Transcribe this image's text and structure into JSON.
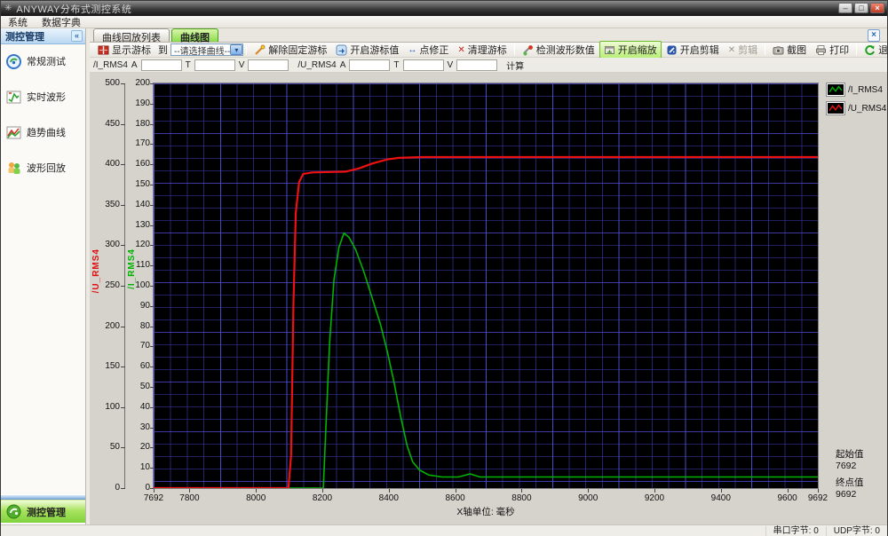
{
  "window": {
    "title": "ANYWAY分布式测控系统"
  },
  "icons": {
    "minimize": "–",
    "restore": "□",
    "close": "×",
    "collapse": "«",
    "dropdown": "▾",
    "tab_close": "×",
    "clear": "✕",
    "clip_disabled": "✕",
    "point_fix": "↔",
    "app": "✳"
  },
  "menu": {
    "items": [
      "系统",
      "数据字典"
    ]
  },
  "sidebar": {
    "header": "测控管理",
    "items": [
      {
        "label": "常规测试"
      },
      {
        "label": "实时波形"
      },
      {
        "label": "趋势曲线"
      },
      {
        "label": "波形回放"
      }
    ],
    "bottom_button": "测控管理"
  },
  "tabs": {
    "items": [
      {
        "label": "曲线回放列表"
      },
      {
        "label": "曲线图"
      }
    ]
  },
  "toolbar": {
    "show_cursor": "显示游标",
    "to_label": "到",
    "curve_select_value": "--请选择曲线--",
    "remove_fixed_cursor": "解除固定游标",
    "open_cursor_value": "开启游标值",
    "point_fix": "点修正",
    "clear_cursor": "清理游标",
    "detect_values": "检测波形数值",
    "open_zoom": "开启缩放",
    "open_clip": "开启剪辑",
    "clip": "剪辑",
    "screenshot": "截图",
    "print": "打印",
    "exit": "退出"
  },
  "fields": {
    "groups": [
      {
        "name": "/I_RMS4",
        "sub": [
          "A",
          "T",
          "V"
        ],
        "values": [
          "",
          "",
          ""
        ]
      },
      {
        "name": "/U_RMS4",
        "sub": [
          "A",
          "T",
          "V"
        ],
        "values": [
          "",
          "",
          ""
        ]
      }
    ],
    "calc_label": "计算"
  },
  "chart_data": {
    "type": "line",
    "x_unit_label": "X轴单位: 毫秒",
    "x_range": [
      7692,
      9692
    ],
    "x_ticks": [
      7692,
      7800,
      8000,
      8200,
      8400,
      8600,
      8800,
      9000,
      9200,
      9400,
      9600,
      9692
    ],
    "grid": true,
    "axes": {
      "left_outer": {
        "label": "/U_RMS4",
        "color": "#e01010",
        "min": 0,
        "max": 500,
        "step": 50
      },
      "left_inner": {
        "label": "/I_RMS4",
        "color": "#00b400",
        "min": 0,
        "max": 200,
        "step": 10
      }
    },
    "legend": [
      {
        "label": "/I_RMS4",
        "color": "#00b400"
      },
      {
        "label": "/U_RMS4",
        "color": "#ee1111"
      }
    ],
    "series": [
      {
        "name": "I_RMS4",
        "color": "#00b400",
        "axis": "left_inner",
        "width": 1.6,
        "points": [
          [
            7692,
            0
          ],
          [
            8203,
            0
          ],
          [
            8212,
            35
          ],
          [
            8222,
            72
          ],
          [
            8235,
            103
          ],
          [
            8250,
            119
          ],
          [
            8265,
            126
          ],
          [
            8280,
            124
          ],
          [
            8300,
            118
          ],
          [
            8325,
            107
          ],
          [
            8350,
            94
          ],
          [
            8375,
            81
          ],
          [
            8395,
            68
          ],
          [
            8415,
            53
          ],
          [
            8435,
            36
          ],
          [
            8455,
            21
          ],
          [
            8472,
            13
          ],
          [
            8492,
            9
          ],
          [
            8520,
            6.5
          ],
          [
            8560,
            5.5
          ],
          [
            8610,
            5.5
          ],
          [
            8645,
            7
          ],
          [
            8675,
            5.5
          ],
          [
            9692,
            5.5
          ]
        ]
      },
      {
        "name": "U_RMS4",
        "color": "#ee1111",
        "axis": "left_outer",
        "width": 2.2,
        "points": [
          [
            7692,
            0
          ],
          [
            8098,
            0
          ],
          [
            8106,
            40
          ],
          [
            8113,
            230
          ],
          [
            8120,
            340
          ],
          [
            8130,
            378
          ],
          [
            8142,
            388
          ],
          [
            8170,
            390
          ],
          [
            8270,
            391
          ],
          [
            8310,
            395
          ],
          [
            8350,
            401
          ],
          [
            8395,
            406
          ],
          [
            8430,
            408
          ],
          [
            8500,
            409
          ],
          [
            9692,
            409
          ]
        ]
      }
    ]
  },
  "info": {
    "start_label": "起始值",
    "start_value": "7692",
    "end_label": "终点值",
    "end_value": "9692"
  },
  "statusbar": {
    "serial": "串口字节: 0",
    "udp": "UDP字节: 0"
  }
}
